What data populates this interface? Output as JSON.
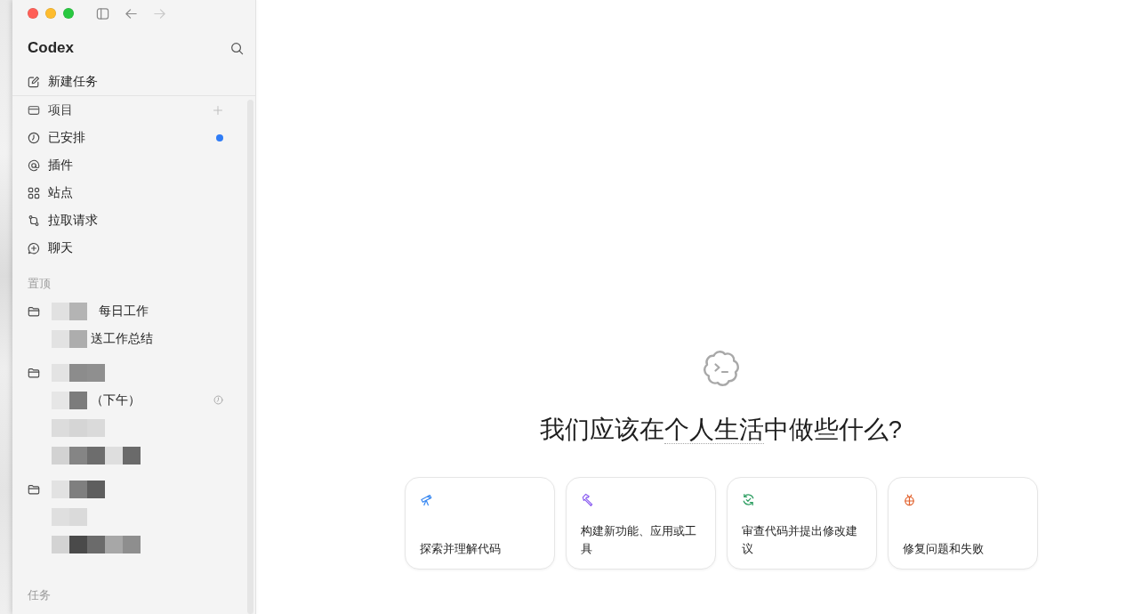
{
  "window": {
    "back": {
      "disabled": false
    },
    "forward": {
      "disabled": true
    }
  },
  "sidebar": {
    "title": "Codex",
    "new_task": "新建任务",
    "nav": [
      {
        "kind": "projects",
        "label": "项目",
        "unread": false
      },
      {
        "kind": "scheduled",
        "label": "已安排",
        "unread": true
      },
      {
        "kind": "plugins",
        "label": "插件",
        "unread": false
      },
      {
        "kind": "sites",
        "label": "站点",
        "unread": false
      },
      {
        "kind": "pull_requests",
        "label": "拉取请求",
        "unread": false
      },
      {
        "kind": "chat",
        "label": "聊天",
        "unread": false
      }
    ],
    "pinned": {
      "heading": "置顶",
      "folders": [
        {
          "label": "每日工作",
          "redacted": true,
          "children": [
            {
              "label": "送工作总结",
              "redacted": true,
              "scheduled": false
            }
          ]
        },
        {
          "redacted": true,
          "children": [
            {
              "label": "（下午）",
              "redacted": true,
              "scheduled": true
            },
            {
              "redacted": true,
              "scheduled": false
            },
            {
              "redacted": true,
              "scheduled": false
            }
          ]
        },
        {
          "redacted": true,
          "children": [
            {
              "redacted": true,
              "scheduled": false
            },
            {
              "redacted": true,
              "scheduled": false
            }
          ]
        }
      ]
    },
    "tasks_heading": "任务"
  },
  "main": {
    "heading": {
      "before": "我们应该在",
      "project": "个人生活",
      "after": "中做些什么?"
    },
    "suggestions": [
      {
        "kind": "explore",
        "label": "探索并理解代码"
      },
      {
        "kind": "build",
        "label": "构建新功能、应用或工具"
      },
      {
        "kind": "review",
        "label": "审查代码并提出修改建议"
      },
      {
        "kind": "fix",
        "label": "修复问题和失败"
      }
    ]
  }
}
